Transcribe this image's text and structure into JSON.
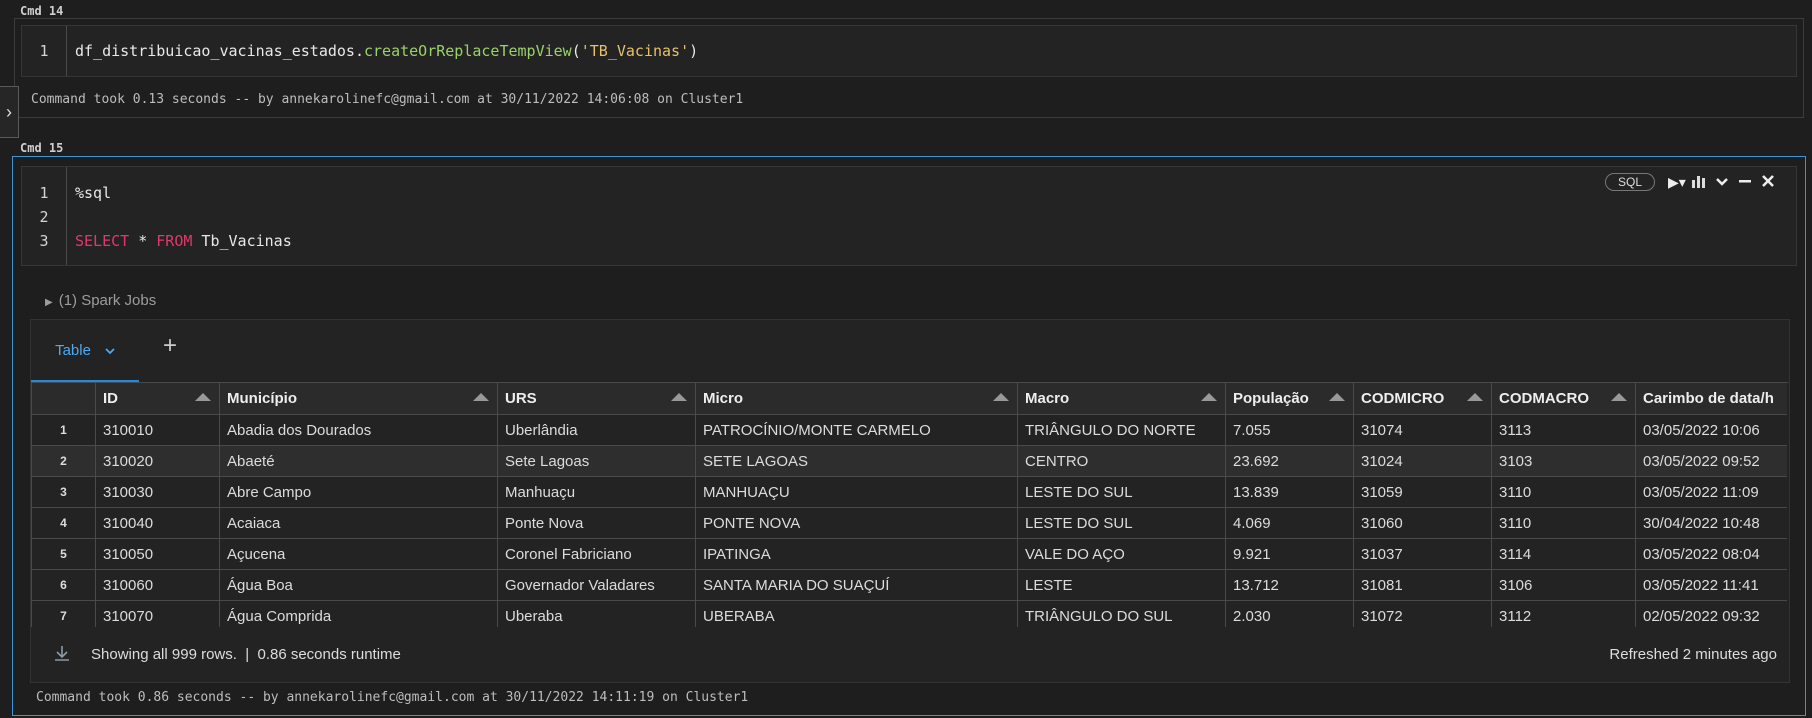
{
  "cell14": {
    "label": "Cmd 14",
    "lines": [
      {
        "num": "1",
        "parts": [
          {
            "text": "df_distribuicao_vacinas_estados.",
            "cls": ""
          },
          {
            "text": "createOrReplaceTempView",
            "cls": "fn"
          },
          {
            "text": "(",
            "cls": ""
          },
          {
            "text": "'TB_Vacinas'",
            "cls": "str"
          },
          {
            "text": ")",
            "cls": ""
          }
        ]
      }
    ],
    "status": "Command took 0.13 seconds -- by annekarolinefc@gmail.com at 30/11/2022 14:06:08 on Cluster1"
  },
  "cell15": {
    "label": "Cmd 15",
    "lang_badge": "SQL",
    "lines": [
      {
        "num": "1",
        "parts": [
          {
            "text": "%sql",
            "cls": ""
          }
        ]
      },
      {
        "num": "2",
        "parts": []
      },
      {
        "num": "3",
        "parts": [
          {
            "text": "SELECT",
            "cls": "kw"
          },
          {
            "text": " * ",
            "cls": ""
          },
          {
            "text": "FROM",
            "cls": "kw"
          },
          {
            "text": " Tb_Vacinas",
            "cls": ""
          }
        ]
      }
    ],
    "spark_jobs": "(1) Spark Jobs",
    "tab_label": "Table",
    "table": {
      "columns": [
        "ID",
        "Município",
        "URS",
        "Micro",
        "Macro",
        "População",
        "CODMICRO",
        "CODMACRO",
        "Carimbo de data/h"
      ],
      "rows": [
        [
          "1",
          "310010",
          "Abadia dos Dourados",
          "Uberlândia",
          "PATROCÍNIO/MONTE CARMELO",
          "TRIÂNGULO DO NORTE",
          "7.055",
          "31074",
          "3113",
          "03/05/2022 10:06"
        ],
        [
          "2",
          "310020",
          "Abaeté",
          "Sete Lagoas",
          "SETE LAGOAS",
          "CENTRO",
          "23.692",
          "31024",
          "3103",
          "03/05/2022 09:52"
        ],
        [
          "3",
          "310030",
          "Abre Campo",
          "Manhuaçu",
          "MANHUAÇU",
          "LESTE DO SUL",
          "13.839",
          "31059",
          "3110",
          "03/05/2022 11:09"
        ],
        [
          "4",
          "310040",
          "Acaiaca",
          "Ponte Nova",
          "PONTE NOVA",
          "LESTE DO SUL",
          "4.069",
          "31060",
          "3110",
          "30/04/2022 10:48"
        ],
        [
          "5",
          "310050",
          "Açucena",
          "Coronel Fabriciano",
          "IPATINGA",
          "VALE DO AÇO",
          "9.921",
          "31037",
          "3114",
          "03/05/2022 08:04"
        ],
        [
          "6",
          "310060",
          "Água Boa",
          "Governador Valadares",
          "SANTA MARIA DO SUAÇUÍ",
          "LESTE",
          "13.712",
          "31081",
          "3106",
          "03/05/2022 11:41"
        ],
        [
          "7",
          "310070",
          "Água Comprida",
          "Uberaba",
          "UBERABA",
          "TRIÂNGULO DO SUL",
          "2.030",
          "31072",
          "3112",
          "02/05/2022 09:32"
        ]
      ],
      "highlight_row": 1
    },
    "footer_left": "Showing all 999 rows.  |  0.86 seconds runtime",
    "footer_right": "Refreshed 2 minutes ago",
    "status": "Command took 0.86 seconds -- by annekarolinefc@gmail.com at 30/11/2022 14:11:19 on Cluster1"
  },
  "icons": {
    "side_toggle": "chevron-right-icon",
    "run": "play-icon",
    "chart": "bar-chart-icon",
    "collapse": "chevron-down-icon",
    "minimize": "minus-icon",
    "close": "close-icon",
    "download": "download-icon"
  }
}
